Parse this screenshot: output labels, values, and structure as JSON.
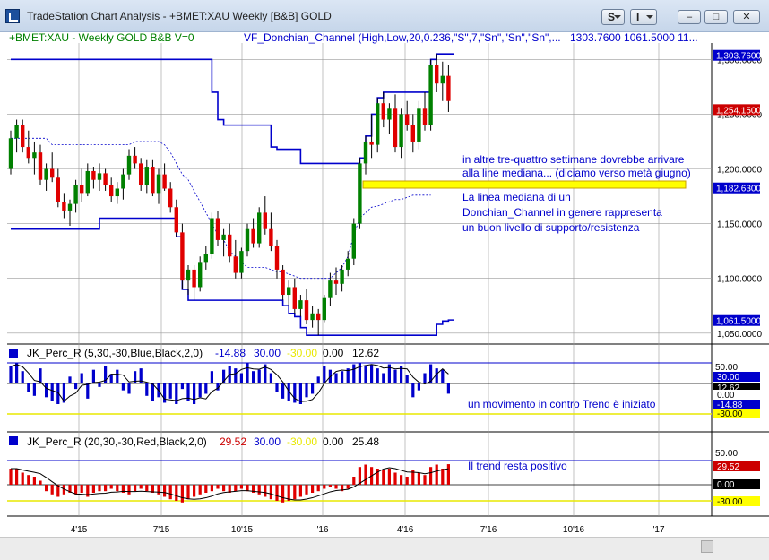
{
  "window": {
    "title": "TradeStation Chart Analysis - +BMET:XAU Weekly [B&B] GOLD",
    "btn_s": "S",
    "btn_i": "I",
    "btn_min": "–",
    "btn_max": "□",
    "btn_close": "✕"
  },
  "header": {
    "symbol_info": "+BMET:XAU - Weekly  GOLD  B&B  V=0",
    "study_label": "VF_Donchian_Channel (High,Low,20,0.236,\"S\",7,\"Sn\",\"Sn\",\"Sn\",...",
    "study_values": "1303.7600   1061.5000   11..."
  },
  "price_axis": {
    "ticks": [
      "1,300.0000",
      "1,250.0000",
      "1,200.0000",
      "1,150.0000",
      "1,100.0000",
      "1,050.0000"
    ],
    "tags": [
      "1,303.7600",
      "1,254.1500",
      "1,182.6300",
      "1,061.5000"
    ]
  },
  "annotations": {
    "line1": "in altre tre-quattro settimane dovrebbe arrivare",
    "line2": "alla line mediana... (diciamo verso metà giugno)",
    "line3": "La linea mediana di un",
    "line4": "Donchian_Channel in genere rappresenta",
    "line5": "un buon livello di supporto/resistenza",
    "ind1_note": "un movimento in contro Trend è iniziato",
    "ind2_note": "Il trend resta positivo"
  },
  "indicator1": {
    "label": "JK_Perc_R (5,30,-30,Blue,Black,2,0)",
    "v1": "-14.88",
    "v2": "30.00",
    "v3": "-30.00",
    "v4": "0.00",
    "v5": "12.62",
    "axis_ticks": [
      "50.00"
    ],
    "tags": [
      "30.00",
      "12.62",
      "0.00",
      "-14.88",
      "-30.00"
    ]
  },
  "indicator2": {
    "label": "JK_Perc_R (20,30,-30,Red,Black,2,0)",
    "v1": "29.52",
    "v2": "30.00",
    "v3": "-30.00",
    "v4": "0.00",
    "v5": "25.48",
    "axis_ticks": [
      "50.00"
    ],
    "tags": [
      "29.52",
      "0.00",
      "-30.00"
    ]
  },
  "time_axis": {
    "labels": [
      "4'15",
      "7'15",
      "10'15",
      "'16",
      "4'16",
      "7'16",
      "10'16",
      "'17"
    ]
  },
  "chart_data": {
    "type": "candlestick",
    "symbol": "+BMET:XAU",
    "interval": "Weekly",
    "ylim": [
      1040,
      1315
    ],
    "price_ticks": [
      1300,
      1250,
      1200,
      1150,
      1100,
      1050
    ],
    "price_tags": [
      1303.76,
      1254.15,
      1182.63,
      1061.5
    ],
    "ohlc": [
      [
        1200,
        1235,
        1195,
        1228
      ],
      [
        1228,
        1245,
        1215,
        1240
      ],
      [
        1240,
        1245,
        1215,
        1220
      ],
      [
        1220,
        1235,
        1205,
        1210
      ],
      [
        1210,
        1225,
        1195,
        1215
      ],
      [
        1215,
        1222,
        1185,
        1190
      ],
      [
        1190,
        1205,
        1180,
        1200
      ],
      [
        1200,
        1215,
        1188,
        1192
      ],
      [
        1192,
        1200,
        1165,
        1170
      ],
      [
        1170,
        1178,
        1155,
        1162
      ],
      [
        1162,
        1172,
        1148,
        1168
      ],
      [
        1168,
        1190,
        1160,
        1185
      ],
      [
        1185,
        1200,
        1170,
        1178
      ],
      [
        1178,
        1205,
        1175,
        1198
      ],
      [
        1198,
        1202,
        1182,
        1190
      ],
      [
        1190,
        1205,
        1180,
        1196
      ],
      [
        1196,
        1200,
        1180,
        1185
      ],
      [
        1185,
        1192,
        1170,
        1175
      ],
      [
        1175,
        1188,
        1168,
        1182
      ],
      [
        1182,
        1200,
        1172,
        1195
      ],
      [
        1195,
        1218,
        1190,
        1212
      ],
      [
        1212,
        1220,
        1200,
        1205
      ],
      [
        1205,
        1210,
        1180,
        1185
      ],
      [
        1185,
        1208,
        1178,
        1202
      ],
      [
        1202,
        1208,
        1175,
        1178
      ],
      [
        1178,
        1200,
        1168,
        1195
      ],
      [
        1195,
        1205,
        1180,
        1182
      ],
      [
        1182,
        1188,
        1160,
        1165
      ],
      [
        1165,
        1172,
        1138,
        1142
      ],
      [
        1142,
        1150,
        1090,
        1098
      ],
      [
        1098,
        1112,
        1085,
        1108
      ],
      [
        1108,
        1112,
        1080,
        1092
      ],
      [
        1092,
        1120,
        1088,
        1115
      ],
      [
        1115,
        1130,
        1108,
        1122
      ],
      [
        1122,
        1160,
        1118,
        1155
      ],
      [
        1155,
        1162,
        1130,
        1135
      ],
      [
        1135,
        1145,
        1120,
        1140
      ],
      [
        1140,
        1150,
        1115,
        1120
      ],
      [
        1120,
        1135,
        1100,
        1105
      ],
      [
        1105,
        1128,
        1100,
        1125
      ],
      [
        1125,
        1150,
        1120,
        1145
      ],
      [
        1145,
        1155,
        1128,
        1132
      ],
      [
        1132,
        1165,
        1128,
        1160
      ],
      [
        1160,
        1175,
        1140,
        1145
      ],
      [
        1145,
        1160,
        1125,
        1130
      ],
      [
        1130,
        1135,
        1100,
        1108
      ],
      [
        1108,
        1112,
        1080,
        1085
      ],
      [
        1085,
        1098,
        1075,
        1092
      ],
      [
        1092,
        1100,
        1068,
        1072
      ],
      [
        1072,
        1085,
        1065,
        1080
      ],
      [
        1080,
        1090,
        1058,
        1062
      ],
      [
        1062,
        1075,
        1055,
        1068
      ],
      [
        1068,
        1072,
        1048,
        1062
      ],
      [
        1062,
        1085,
        1060,
        1082
      ],
      [
        1082,
        1105,
        1075,
        1098
      ],
      [
        1098,
        1110,
        1085,
        1095
      ],
      [
        1095,
        1112,
        1088,
        1108
      ],
      [
        1108,
        1125,
        1102,
        1118
      ],
      [
        1118,
        1155,
        1112,
        1150
      ],
      [
        1150,
        1210,
        1145,
        1205
      ],
      [
        1205,
        1230,
        1195,
        1225
      ],
      [
        1225,
        1250,
        1210,
        1222
      ],
      [
        1222,
        1265,
        1215,
        1260
      ],
      [
        1260,
        1270,
        1238,
        1245
      ],
      [
        1245,
        1260,
        1232,
        1255
      ],
      [
        1255,
        1268,
        1215,
        1220
      ],
      [
        1220,
        1255,
        1210,
        1250
      ],
      [
        1250,
        1262,
        1235,
        1240
      ],
      [
        1240,
        1250,
        1215,
        1225
      ],
      [
        1225,
        1262,
        1218,
        1255
      ],
      [
        1255,
        1270,
        1235,
        1240
      ],
      [
        1240,
        1300,
        1235,
        1295
      ],
      [
        1295,
        1305,
        1270,
        1278
      ],
      [
        1278,
        1298,
        1262,
        1285
      ],
      [
        1285,
        1295,
        1252,
        1262
      ]
    ],
    "donchian_upper": [
      1300,
      1300,
      1300,
      1300,
      1300,
      1300,
      1300,
      1300,
      1300,
      1300,
      1300,
      1300,
      1300,
      1300,
      1300,
      1300,
      1300,
      1300,
      1300,
      1300,
      1300,
      1300,
      1300,
      1300,
      1300,
      1300,
      1300,
      1300,
      1300,
      1300,
      1300,
      1300,
      1300,
      1300,
      1270,
      1245,
      1240,
      1240,
      1240,
      1240,
      1240,
      1240,
      1240,
      1240,
      1220,
      1218,
      1218,
      1218,
      1218,
      1205,
      1205,
      1205,
      1205,
      1205,
      1205,
      1205,
      1205,
      1205,
      1205,
      1210,
      1230,
      1250,
      1265,
      1270,
      1270,
      1270,
      1270,
      1270,
      1270,
      1270,
      1270,
      1300,
      1305,
      1305,
      1305
    ],
    "donchian_lower": [
      1145,
      1145,
      1145,
      1145,
      1145,
      1145,
      1145,
      1145,
      1145,
      1145,
      1145,
      1145,
      1145,
      1145,
      1145,
      1155,
      1155,
      1155,
      1155,
      1155,
      1155,
      1155,
      1155,
      1155,
      1155,
      1155,
      1155,
      1155,
      1138,
      1090,
      1080,
      1080,
      1080,
      1080,
      1080,
      1080,
      1080,
      1080,
      1080,
      1080,
      1080,
      1080,
      1080,
      1080,
      1080,
      1080,
      1075,
      1068,
      1065,
      1055,
      1048,
      1048,
      1048,
      1048,
      1048,
      1048,
      1048,
      1048,
      1048,
      1048,
      1048,
      1048,
      1048,
      1048,
      1048,
      1048,
      1048,
      1048,
      1048,
      1048,
      1048,
      1048,
      1058,
      1061,
      1062
    ],
    "donchian_mid": [
      1228,
      1228,
      1228,
      1228,
      1228,
      1228,
      1228,
      1222,
      1222,
      1222,
      1222,
      1222,
      1222,
      1222,
      1222,
      1222,
      1222,
      1222,
      1222,
      1222,
      1222,
      1225,
      1225,
      1225,
      1225,
      1225,
      1222,
      1215,
      1205,
      1195,
      1190,
      1180,
      1170,
      1160,
      1150,
      1140,
      1135,
      1125,
      1120,
      1115,
      1110,
      1110,
      1110,
      1110,
      1108,
      1106,
      1106,
      1104,
      1102,
      1100,
      1100,
      1100,
      1100,
      1100,
      1100,
      1105,
      1110,
      1120,
      1140,
      1155,
      1160,
      1165,
      1166,
      1168,
      1170,
      1172,
      1172,
      1174,
      1176,
      1176,
      1176,
      1176
    ],
    "ind1_values": [
      25,
      30,
      18,
      -12,
      -18,
      22,
      -20,
      -25,
      -30,
      -28,
      10,
      -8,
      15,
      -22,
      20,
      -5,
      25,
      14,
      20,
      -10,
      -15,
      18,
      22,
      -18,
      -25,
      -20,
      -28,
      -22,
      -30,
      -8,
      -25,
      -30,
      -20,
      -15,
      18,
      -10,
      20,
      25,
      22,
      15,
      30,
      18,
      20,
      28,
      15,
      -12,
      -22,
      -25,
      -28,
      -30,
      -20,
      -15,
      10,
      25,
      20,
      15,
      18,
      22,
      28,
      30,
      25,
      28,
      22,
      15,
      28,
      20,
      25,
      12,
      -20,
      -10,
      15,
      28,
      22,
      20,
      -14.88
    ],
    "ind2_values": [
      20,
      20,
      15,
      12,
      10,
      5,
      -8,
      -12,
      -15,
      -12,
      -10,
      -12,
      -10,
      -15,
      -10,
      -8,
      -8,
      -5,
      -8,
      -10,
      -12,
      -8,
      -5,
      -8,
      -10,
      -12,
      -15,
      -18,
      -20,
      -22,
      -18,
      -15,
      -12,
      -10,
      -8,
      -5,
      -8,
      -10,
      -8,
      -5,
      -8,
      -10,
      -12,
      -15,
      -18,
      -20,
      -22,
      -20,
      -18,
      -15,
      -12,
      -10,
      -8,
      -5,
      -3,
      -5,
      -8,
      -5,
      10,
      22,
      25,
      22,
      20,
      18,
      20,
      15,
      12,
      10,
      18,
      15,
      12,
      22,
      25,
      20,
      25.48
    ]
  }
}
